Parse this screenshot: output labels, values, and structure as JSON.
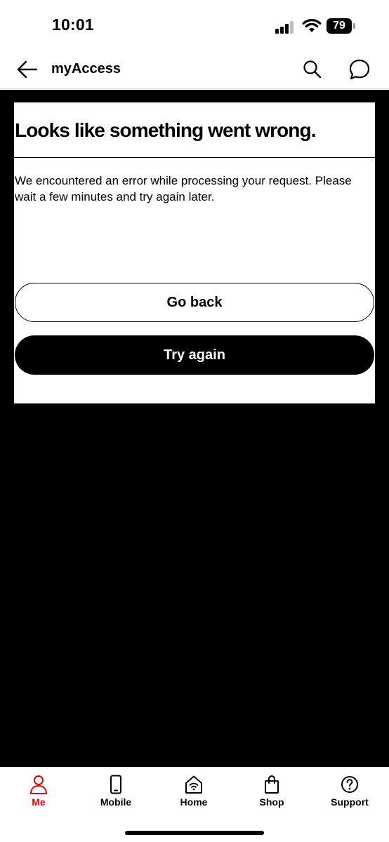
{
  "status_bar": {
    "time": "10:01",
    "battery": "79"
  },
  "header": {
    "title": "myAccess",
    "back_icon": "arrow-left-icon",
    "search_icon": "search-icon",
    "chat_icon": "chat-bubble-icon"
  },
  "error": {
    "title": "Looks like something went wrong.",
    "message": "We encountered an error while processing your request. Please wait a few minutes and try again later.",
    "go_back_label": "Go back",
    "try_again_label": "Try again"
  },
  "bottom_nav": {
    "active_color": "#ee0000",
    "items": [
      {
        "label": "Me",
        "icon": "person-icon",
        "active": true
      },
      {
        "label": "Mobile",
        "icon": "phone-icon",
        "active": false
      },
      {
        "label": "Home",
        "icon": "home-wifi-icon",
        "active": false
      },
      {
        "label": "Shop",
        "icon": "shopping-bag-icon",
        "active": false
      },
      {
        "label": "Support",
        "icon": "help-circle-icon",
        "active": false
      }
    ]
  }
}
